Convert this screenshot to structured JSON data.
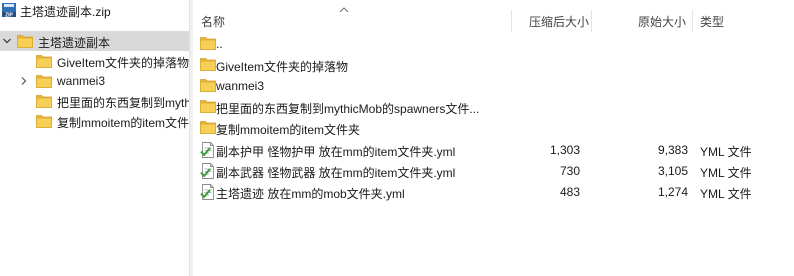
{
  "tree": {
    "root": {
      "label": "主塔遗迹副本.zip",
      "icon": "zip-archive-icon"
    },
    "items": [
      {
        "label": "主塔遗迹副本",
        "icon": "folder-icon",
        "expanded": true,
        "selected": true
      },
      {
        "label": "GiveItem文件夹的掉落物",
        "icon": "folder-icon"
      },
      {
        "label": "wanmei3",
        "icon": "folder-icon",
        "has_children": true
      },
      {
        "label": "把里面的东西复制到mythicMob的spawners文件夹",
        "icon": "folder-icon"
      },
      {
        "label": "复制mmoitem的item文件夹",
        "icon": "folder-icon"
      }
    ]
  },
  "columns": {
    "name": "名称",
    "compressed": "压缩后大小",
    "original": "原始大小",
    "type": "类型"
  },
  "files": [
    {
      "name": "..",
      "kind": "folder",
      "icon": "folder-icon",
      "compressed": "",
      "original": "",
      "type": ""
    },
    {
      "name": "GiveItem文件夹的掉落物",
      "kind": "folder",
      "icon": "folder-icon",
      "compressed": "",
      "original": "",
      "type": ""
    },
    {
      "name": "wanmei3",
      "kind": "folder",
      "icon": "folder-icon",
      "compressed": "",
      "original": "",
      "type": ""
    },
    {
      "name": "把里面的东西复制到mythicMob的spawners文件...",
      "kind": "folder",
      "icon": "folder-icon",
      "compressed": "",
      "original": "",
      "type": ""
    },
    {
      "name": "复制mmoitem的item文件夹",
      "kind": "folder",
      "icon": "folder-icon",
      "compressed": "",
      "original": "",
      "type": ""
    },
    {
      "name": "副本护甲 怪物护甲 放在mm的item文件夹.yml",
      "kind": "file",
      "icon": "yml-file-icon",
      "compressed": "1,303",
      "original": "9,383",
      "type": "YML 文件"
    },
    {
      "name": "副本武器 怪物武器 放在mm的item文件夹.yml",
      "kind": "file",
      "icon": "yml-file-icon",
      "compressed": "730",
      "original": "3,105",
      "type": "YML 文件"
    },
    {
      "name": "主塔遗迹 放在mm的mob文件夹.yml",
      "kind": "file",
      "icon": "yml-file-icon",
      "compressed": "483",
      "original": "1,274",
      "type": "YML 文件"
    }
  ],
  "colors": {
    "folder": "#f3c742",
    "selected_row": "#d9d9d9",
    "yml_green": "#3a9b3a"
  }
}
